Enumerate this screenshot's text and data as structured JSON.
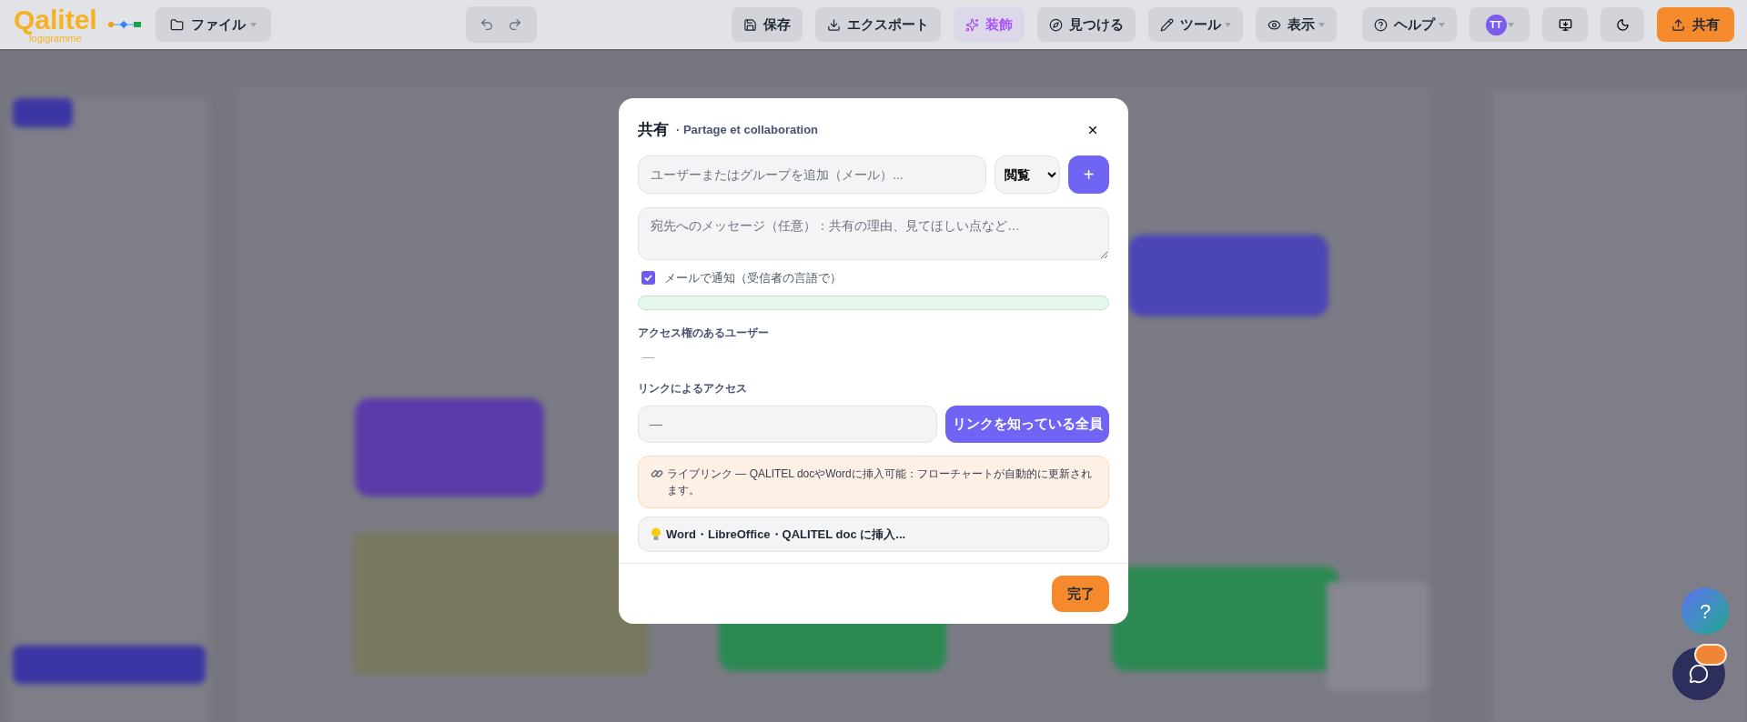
{
  "logo": {
    "name": "Qalitel",
    "tagline": "logigramme"
  },
  "file_menu": {
    "label": "ファイル",
    "dropdown": true
  },
  "toolbar": [
    {
      "label": "保存",
      "dropdown": false,
      "selected": false
    },
    {
      "label": "エクスポート",
      "dropdown": false,
      "selected": false
    },
    {
      "label": "装飾",
      "dropdown": false,
      "selected": true
    },
    {
      "label": "見つける",
      "dropdown": false,
      "selected": false
    },
    {
      "label": "ツール",
      "dropdown": true,
      "selected": false
    },
    {
      "label": "表示",
      "dropdown": true,
      "selected": false
    }
  ],
  "help_menu": {
    "label": "ヘルプ",
    "dropdown": true
  },
  "user": {
    "initials": "TT",
    "dropdown": true
  },
  "share_button": {
    "label": "共有"
  },
  "share_dialog": {
    "title": "共有",
    "subtitle": "· Partage et collaboration",
    "invite_placeholder": "ユーザーまたはグループを追加（メール）...",
    "role": "閲覧",
    "add_label": "+",
    "message_placeholder": "宛先へのメッセージ（任意）：共有の理由、見てほしい点など…",
    "notify": {
      "label": "メールで通知（受信者の言語で）",
      "checked": true
    },
    "users_heading": "アクセス権のあるユーザー",
    "users_empty": "—",
    "link_heading": "リンクによるアクセス",
    "link_value": "—",
    "link_scope": "リンクを知っている全員",
    "live_link_note": "ライブリンク — QALITEL docやWordに挿入可能：フローチャートが自動的に更新されます。",
    "insert_tip": "Word・LibreOffice・QALITEL doc に挿入...",
    "done_label": "完了"
  },
  "help_fab": {
    "label": "?"
  },
  "chat_fab": {
    "badge": true
  }
}
